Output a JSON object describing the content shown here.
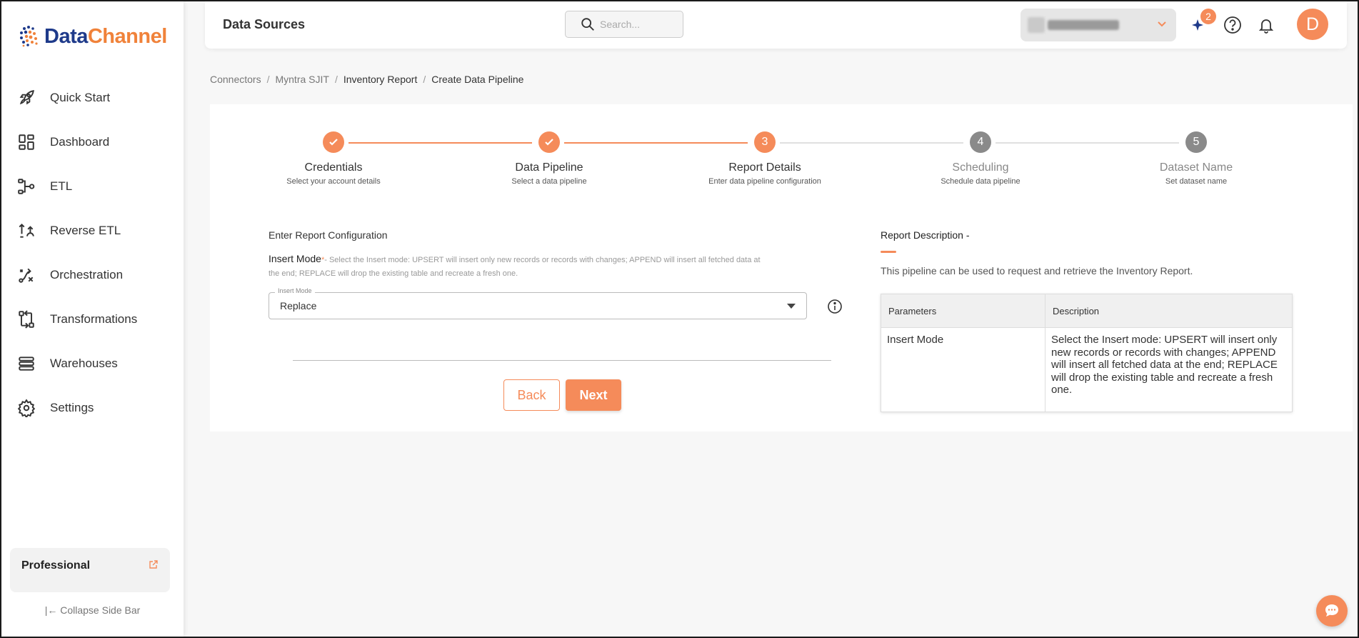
{
  "brand": {
    "name_part1": "Data",
    "name_part2": "Channel"
  },
  "sidebar": {
    "items": [
      {
        "label": "Quick Start",
        "icon": "rocket-icon"
      },
      {
        "label": "Dashboard",
        "icon": "dashboard-icon"
      },
      {
        "label": "ETL",
        "icon": "etl-icon"
      },
      {
        "label": "Reverse ETL",
        "icon": "reverse-etl-icon"
      },
      {
        "label": "Orchestration",
        "icon": "orchestration-icon"
      },
      {
        "label": "Transformations",
        "icon": "transformations-icon"
      },
      {
        "label": "Warehouses",
        "icon": "warehouses-icon"
      },
      {
        "label": "Settings",
        "icon": "gear-icon"
      }
    ],
    "plan": "Professional",
    "collapse_label": "Collapse Side Bar"
  },
  "header": {
    "title": "Data Sources",
    "search_placeholder": "Search...",
    "notification_count": "2",
    "avatar_initial": "D"
  },
  "breadcrumb": [
    "Connectors",
    "Myntra SJIT",
    "Inventory Report",
    "Create Data Pipeline"
  ],
  "stepper": [
    {
      "number": "1",
      "title": "Credentials",
      "subtitle": "Select your account details",
      "status": "done"
    },
    {
      "number": "2",
      "title": "Data Pipeline",
      "subtitle": "Select a data pipeline",
      "status": "done"
    },
    {
      "number": "3",
      "title": "Report Details",
      "subtitle": "Enter data pipeline configuration",
      "status": "active"
    },
    {
      "number": "4",
      "title": "Scheduling",
      "subtitle": "Schedule data pipeline",
      "status": "pending"
    },
    {
      "number": "5",
      "title": "Dataset Name",
      "subtitle": "Set dataset name",
      "status": "pending"
    }
  ],
  "form": {
    "section_title": "Enter Report Configuration",
    "field_label": "Insert Mode",
    "required_mark": "*",
    "field_help": "- Select the Insert mode: UPSERT will insert only new records or records with changes; APPEND will insert all fetched data at the end; REPLACE will drop the existing table and recreate a fresh one.",
    "select_floating_label": "Insert Mode",
    "select_value": "Replace",
    "back_label": "Back",
    "next_label": "Next"
  },
  "description": {
    "title": "Report Description -",
    "text": "This pipeline can be used to request and retrieve the Inventory Report.",
    "table": {
      "headers": [
        "Parameters",
        "Description"
      ],
      "rows": [
        [
          "Insert Mode",
          "Select the Insert mode: UPSERT will insert only new records or records with changes; APPEND will insert all fetched data at the end; REPLACE will drop the existing table and recreate a fresh one."
        ]
      ]
    }
  },
  "colors": {
    "accent": "#f58b5a",
    "brand_blue": "#1e3a8a",
    "brand_orange": "#f0823a",
    "pending": "#8a8a8a"
  }
}
